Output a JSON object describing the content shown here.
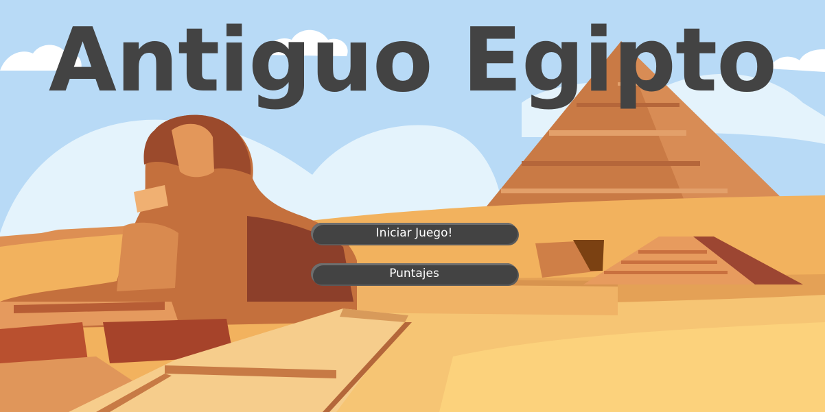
{
  "game": {
    "title": "Antiguo Egipto"
  },
  "menu": {
    "start_label": "Iniciar Juego!",
    "scores_label": "Puntajes"
  },
  "colors": {
    "sky": "#b8daf6",
    "title_text": "#434343",
    "button_bg": "#434343",
    "button_text": "#ffffff",
    "sand": "#f4b967",
    "pyramid": "#c97a45"
  },
  "scene": {
    "elements": [
      "sky",
      "clouds",
      "sphinx",
      "pyramid",
      "small-step-pyramid",
      "stone-walkway",
      "desert-dunes"
    ]
  }
}
